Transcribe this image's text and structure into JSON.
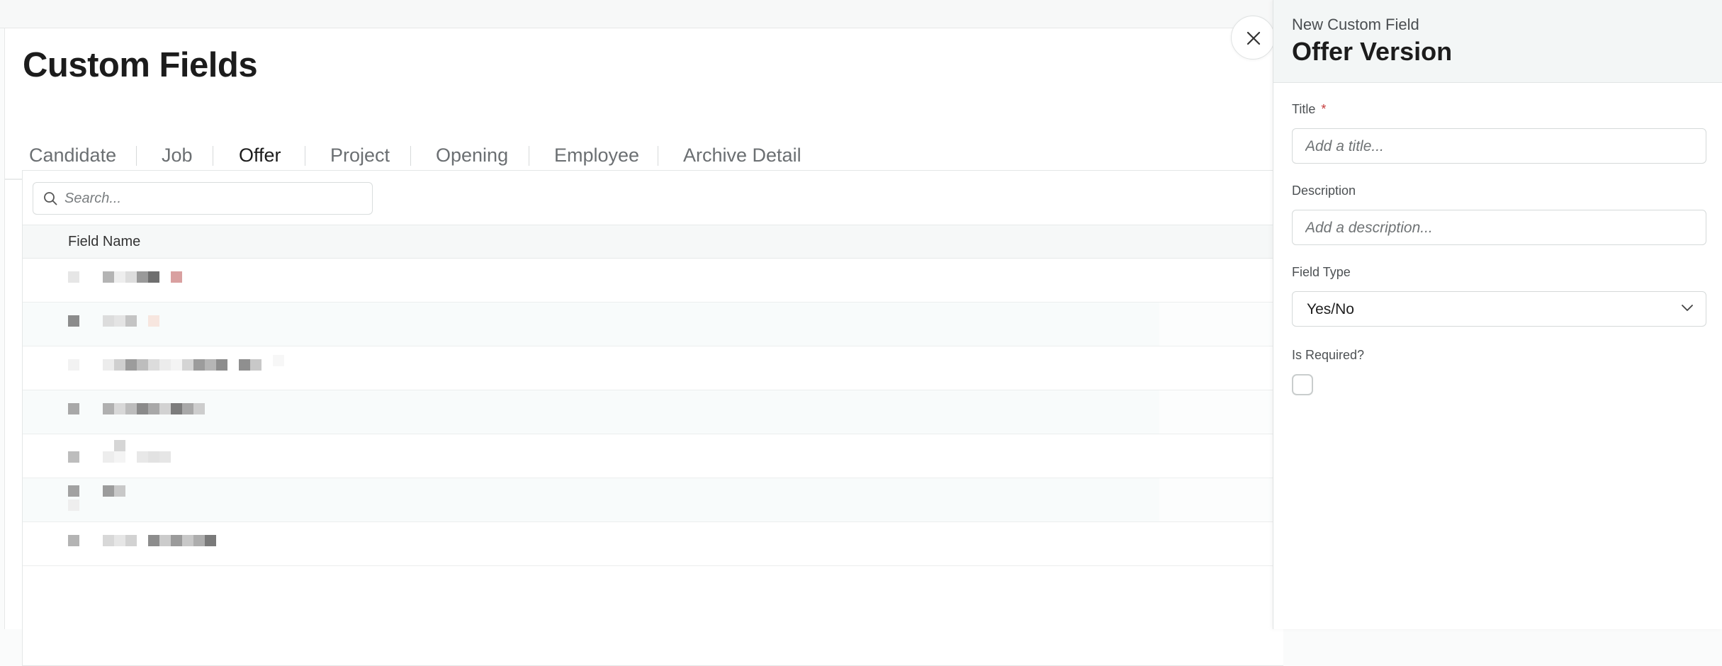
{
  "page": {
    "title": "Custom Fields"
  },
  "tabs": [
    {
      "label": "Candidate"
    },
    {
      "label": "Job"
    },
    {
      "label": "Offer",
      "active": true
    },
    {
      "label": "Project"
    },
    {
      "label": "Opening"
    },
    {
      "label": "Employee"
    },
    {
      "label": "Archive Detail"
    }
  ],
  "search": {
    "placeholder": "Search..."
  },
  "table": {
    "columns": [
      "Field Name"
    ],
    "rows": [
      {
        "redacted": true
      },
      {
        "redacted": true
      },
      {
        "redacted": true
      },
      {
        "redacted": true
      },
      {
        "redacted": true
      },
      {
        "redacted": true
      },
      {
        "redacted": true
      }
    ]
  },
  "drawer": {
    "subtitle": "New Custom Field",
    "title": "Offer Version",
    "title_field": {
      "label": "Title",
      "required_mark": "*",
      "placeholder": "Add a title..."
    },
    "description_field": {
      "label": "Description",
      "placeholder": "Add a description..."
    },
    "field_type": {
      "label": "Field Type",
      "value": "Yes/No"
    },
    "is_required": {
      "label": "Is Required?",
      "checked": false
    }
  },
  "colors": {
    "accent": "#5b4ea8",
    "required": "#c53b3b"
  },
  "icons": {
    "search": "search-icon",
    "close": "close-icon",
    "dropdown": "chevron-down-icon"
  }
}
